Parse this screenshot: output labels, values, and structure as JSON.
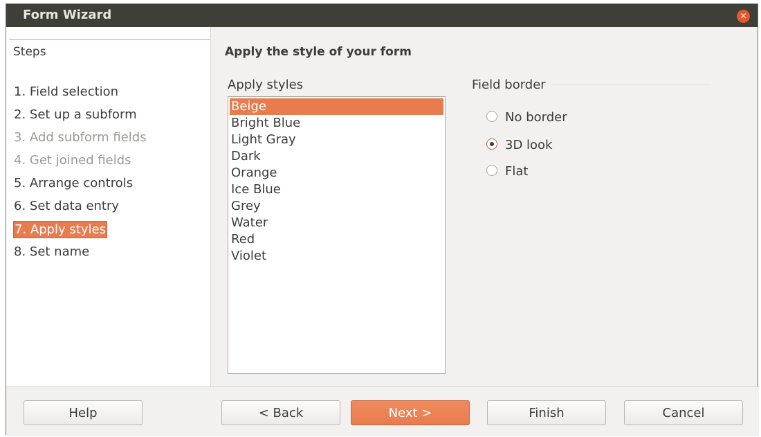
{
  "window": {
    "title": "Form Wizard",
    "close_icon": "close-icon"
  },
  "steps": {
    "title": "Steps",
    "items": [
      {
        "label": "1. Field selection",
        "state": "normal"
      },
      {
        "label": "2. Set up a subform",
        "state": "normal"
      },
      {
        "label": "3. Add subform fields",
        "state": "disabled"
      },
      {
        "label": "4. Get joined fields",
        "state": "disabled"
      },
      {
        "label": "5. Arrange controls",
        "state": "normal"
      },
      {
        "label": "6. Set data entry",
        "state": "normal"
      },
      {
        "label": "7. Apply styles",
        "state": "active"
      },
      {
        "label": "8. Set name",
        "state": "normal"
      }
    ]
  },
  "main": {
    "heading": "Apply the style of your form",
    "styles_label": "Apply styles",
    "styles": [
      "Beige",
      "Bright Blue",
      "Light Gray",
      "Dark",
      "Orange",
      "Ice Blue",
      "Grey",
      "Water",
      "Red",
      "Violet"
    ],
    "selected_style": "Beige",
    "field_border": {
      "label": "Field border",
      "options": [
        {
          "label": "No border",
          "selected": false
        },
        {
          "label": "3D look",
          "selected": true
        },
        {
          "label": "Flat",
          "selected": false
        }
      ]
    }
  },
  "buttons": {
    "help": "Help",
    "back": "< Back",
    "next": "Next >",
    "finish": "Finish",
    "cancel": "Cancel"
  },
  "colors": {
    "accent": "#e87c4f",
    "titlebar": "#3f3e39",
    "close": "#e45a2c"
  }
}
